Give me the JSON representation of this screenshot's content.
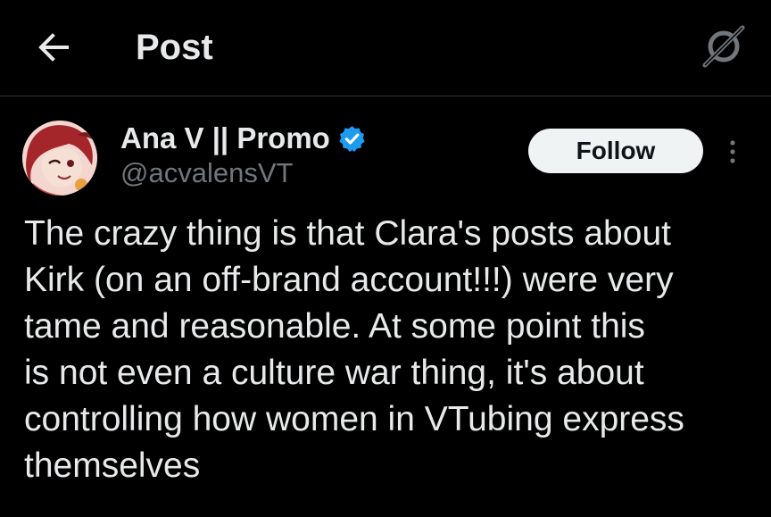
{
  "header": {
    "title": "Post",
    "back_icon": "arrow-left-icon",
    "grok_icon": "grok-icon"
  },
  "author": {
    "display_name": "Ana V || Promo",
    "handle": "@acvalensVT",
    "verified": true,
    "verified_color": "#1d9bf0",
    "follow_label": "Follow",
    "more_icon": "more-vertical-icon"
  },
  "post": {
    "lines": [
      "The crazy thing is that Clara's posts about",
      "Kirk (on an off-brand account!!!) were very",
      "tame and reasonable. At some point this",
      "is not even a culture war thing, it's about",
      "controlling how women in VTubing express",
      "themselves"
    ]
  },
  "colors": {
    "background": "#000000",
    "text": "#e7e9ea",
    "secondary_text": "#71767b",
    "divider": "#2f3336",
    "follow_bg": "#eff3f4"
  }
}
